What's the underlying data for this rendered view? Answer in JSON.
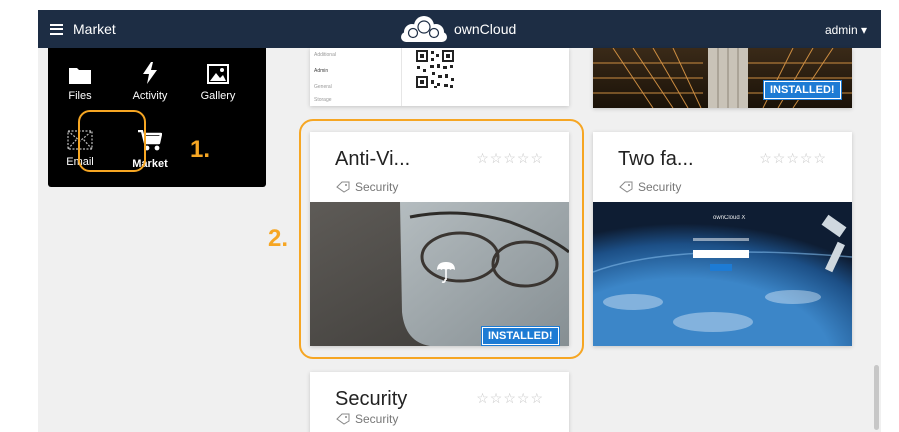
{
  "header": {
    "app_title": "Market",
    "brand": "ownCloud",
    "user": "admin ▾"
  },
  "app_menu": {
    "items": [
      {
        "label": "Files",
        "icon": "folder-icon"
      },
      {
        "label": "Activity",
        "icon": "lightning-icon"
      },
      {
        "label": "Gallery",
        "icon": "image-icon"
      },
      {
        "label": "Email",
        "icon": "email-icon"
      },
      {
        "label": "Market",
        "icon": "cart-icon"
      }
    ]
  },
  "annotations": {
    "step1": "1.",
    "step2": "2."
  },
  "top_card": {
    "menu_items": [
      "Additional",
      "Admin",
      "General",
      "Storage"
    ]
  },
  "installed_badge": "INSTALLED!",
  "cards": [
    {
      "title": "Anti-Vi...",
      "category": "Security",
      "badge": "INSTALLED!",
      "stars": "☆☆☆☆☆"
    },
    {
      "title": "Two fa...",
      "category": "Security",
      "stars": "☆☆☆☆☆"
    },
    {
      "title": "Security",
      "category": "Security",
      "stars": "☆☆☆☆☆"
    }
  ],
  "colors": {
    "topbar": "#1d2d44",
    "highlight": "#f6a623",
    "badge": "#1d7bd4"
  }
}
